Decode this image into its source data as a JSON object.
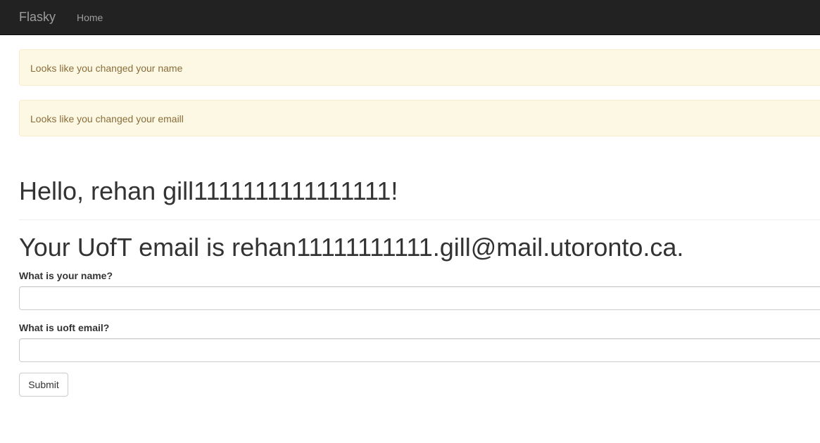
{
  "navbar": {
    "brand": "Flasky",
    "links": [
      {
        "label": "Home"
      }
    ],
    "background_color": "#222222",
    "link_color": "#9d9d9d"
  },
  "alerts": [
    {
      "message": "Looks like you changed your name"
    },
    {
      "message": "Looks like you changed your emaill"
    }
  ],
  "alert_colors": {
    "background": "#fcf8e3",
    "border": "#faebcc",
    "text": "#8a6d3b"
  },
  "main": {
    "greeting": "Hello, rehan gill1111111111111111!",
    "email_message": "Your UofT email is rehan11111111111.gill@mail.utoronto.ca."
  },
  "form": {
    "name_label": "What is your name?",
    "name_value": "",
    "email_label": "What is uoft email?",
    "email_value": "",
    "submit_label": "Submit"
  }
}
